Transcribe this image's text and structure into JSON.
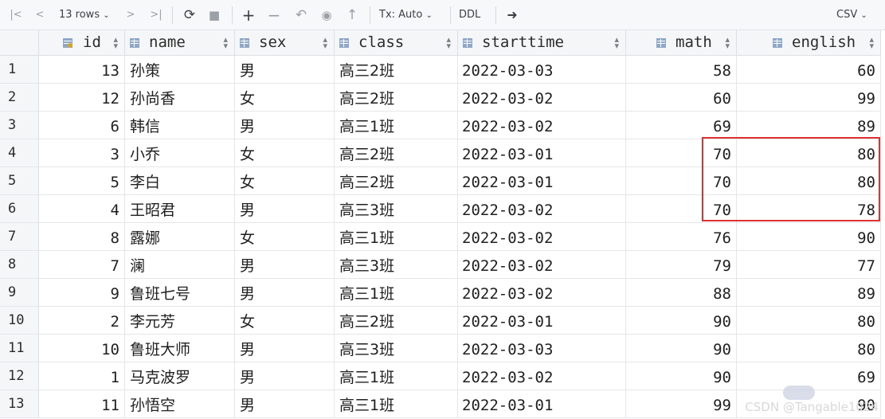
{
  "toolbar": {
    "rows_label": "13 rows",
    "tx_label": "Tx: Auto",
    "ddl_label": "DDL",
    "export_label": "CSV"
  },
  "columns": [
    "id",
    "name",
    "sex",
    "class",
    "starttime",
    "math",
    "english"
  ],
  "rows": [
    {
      "n": "1",
      "id": "13",
      "name": "孙策",
      "sex": "男",
      "class": "高三2班",
      "starttime": "2022-03-03",
      "math": "58",
      "english": "60"
    },
    {
      "n": "2",
      "id": "12",
      "name": "孙尚香",
      "sex": "女",
      "class": "高三2班",
      "starttime": "2022-03-02",
      "math": "60",
      "english": "99"
    },
    {
      "n": "3",
      "id": "6",
      "name": "韩信",
      "sex": "男",
      "class": "高三1班",
      "starttime": "2022-03-02",
      "math": "69",
      "english": "89"
    },
    {
      "n": "4",
      "id": "3",
      "name": "小乔",
      "sex": "女",
      "class": "高三2班",
      "starttime": "2022-03-01",
      "math": "70",
      "english": "80"
    },
    {
      "n": "5",
      "id": "5",
      "name": "李白",
      "sex": "女",
      "class": "高三2班",
      "starttime": "2022-03-01",
      "math": "70",
      "english": "80"
    },
    {
      "n": "6",
      "id": "4",
      "name": "王昭君",
      "sex": "男",
      "class": "高三3班",
      "starttime": "2022-03-02",
      "math": "70",
      "english": "78"
    },
    {
      "n": "7",
      "id": "8",
      "name": "露娜",
      "sex": "女",
      "class": "高三1班",
      "starttime": "2022-03-02",
      "math": "76",
      "english": "90"
    },
    {
      "n": "8",
      "id": "7",
      "name": "澜",
      "sex": "男",
      "class": "高三3班",
      "starttime": "2022-03-02",
      "math": "79",
      "english": "77"
    },
    {
      "n": "9",
      "id": "9",
      "name": "鲁班七号",
      "sex": "男",
      "class": "高三1班",
      "starttime": "2022-03-02",
      "math": "88",
      "english": "89"
    },
    {
      "n": "10",
      "id": "2",
      "name": "李元芳",
      "sex": "女",
      "class": "高三2班",
      "starttime": "2022-03-01",
      "math": "90",
      "english": "80"
    },
    {
      "n": "11",
      "id": "10",
      "name": "鲁班大师",
      "sex": "男",
      "class": "高三3班",
      "starttime": "2022-03-03",
      "math": "90",
      "english": "80"
    },
    {
      "n": "12",
      "id": "1",
      "name": "马克波罗",
      "sex": "男",
      "class": "高三1班",
      "starttime": "2022-03-02",
      "math": "90",
      "english": "69"
    },
    {
      "n": "13",
      "id": "11",
      "name": "孙悟空",
      "sex": "男",
      "class": "高三1班",
      "starttime": "2022-03-01",
      "math": "99",
      "english": "90"
    }
  ],
  "watermark": "CSDN @Tangable1024",
  "colors": {
    "highlight": "#e03131",
    "header_bg": "#f5f6f7"
  }
}
